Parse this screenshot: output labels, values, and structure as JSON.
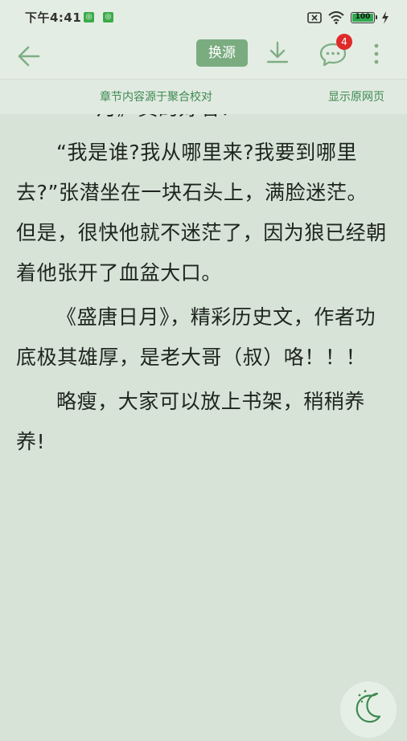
{
  "status_bar": {
    "time": "下午4:41",
    "battery": "100"
  },
  "toolbar": {
    "source_button": "换源",
    "comment_count": "4"
  },
  "source_strip": {
    "note": "章节内容源于聚合校对",
    "original_link": "显示原网页"
  },
  "content": {
    "cut_line": "月》真的好看！",
    "paragraphs": [
      "“我是谁?我从哪里来?我要到哪里去?”张潜坐在一块石头上，满脸迷茫。但是，很快他就不迷茫了，因为狼已经朝着他张开了血盆大口。",
      "《盛唐日月》，精彩历史文，作者功底极其雄厚，是老大哥（叔）咯！！！",
      "略瘦，大家可以放上书架，稍稍养养!"
    ]
  },
  "colors": {
    "accent": "#3d8a52",
    "source_button_bg": "#7bac80",
    "page_bg": "#d7e3d7",
    "badge": "#e02a2a"
  },
  "icons": [
    "back-arrow-icon",
    "download-icon",
    "comment-icon",
    "more-vertical-icon",
    "moon-icon",
    "wifi-icon",
    "battery-icon",
    "sim-icon",
    "charging-icon"
  ]
}
